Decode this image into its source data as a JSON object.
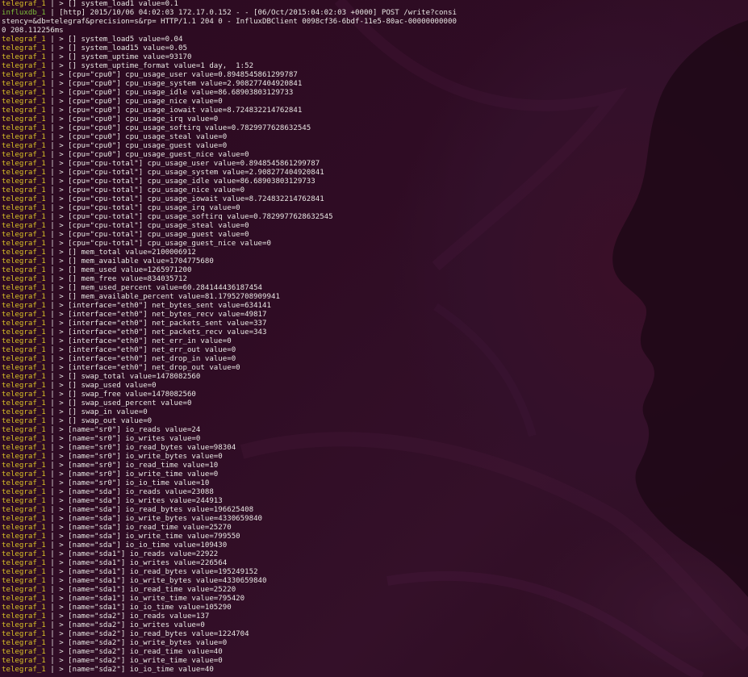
{
  "terminal": {
    "separator": " | ",
    "lines": [
      {
        "src": "telegraf_1",
        "text": "> [] system_load1 value=0.1"
      },
      {
        "src": "influxdb_1",
        "text": "[http] 2015/10/06 04:02:03 172.17.0.152 - - [06/Oct/2015:04:02:03 +0000] POST /write?consi"
      },
      {
        "src": "",
        "text": "stency=&db=telegraf&precision=s&rp= HTTP/1.1 204 0 - InfluxDBClient 0098cf36-6bdf-11e5-80ac-00000000000"
      },
      {
        "src": "",
        "text": "0 208.112256ms"
      },
      {
        "src": "telegraf_1",
        "text": "> [] system_load5 value=0.04"
      },
      {
        "src": "telegraf_1",
        "text": "> [] system_load15 value=0.05"
      },
      {
        "src": "telegraf_1",
        "text": "> [] system_uptime value=93170"
      },
      {
        "src": "telegraf_1",
        "text": "> [] system_uptime_format value=1 day,  1:52"
      },
      {
        "src": "telegraf_1",
        "text": "> [cpu=\"cpu0\"] cpu_usage_user value=0.8948545861299787"
      },
      {
        "src": "telegraf_1",
        "text": "> [cpu=\"cpu0\"] cpu_usage_system value=2.908277404920841"
      },
      {
        "src": "telegraf_1",
        "text": "> [cpu=\"cpu0\"] cpu_usage_idle value=86.68903803129733"
      },
      {
        "src": "telegraf_1",
        "text": "> [cpu=\"cpu0\"] cpu_usage_nice value=0"
      },
      {
        "src": "telegraf_1",
        "text": "> [cpu=\"cpu0\"] cpu_usage_iowait value=8.724832214762841"
      },
      {
        "src": "telegraf_1",
        "text": "> [cpu=\"cpu0\"] cpu_usage_irq value=0"
      },
      {
        "src": "telegraf_1",
        "text": "> [cpu=\"cpu0\"] cpu_usage_softirq value=0.7829977628632545"
      },
      {
        "src": "telegraf_1",
        "text": "> [cpu=\"cpu0\"] cpu_usage_steal value=0"
      },
      {
        "src": "telegraf_1",
        "text": "> [cpu=\"cpu0\"] cpu_usage_guest value=0"
      },
      {
        "src": "telegraf_1",
        "text": "> [cpu=\"cpu0\"] cpu_usage_guest_nice value=0"
      },
      {
        "src": "telegraf_1",
        "text": "> [cpu=\"cpu-total\"] cpu_usage_user value=0.8948545861299787"
      },
      {
        "src": "telegraf_1",
        "text": "> [cpu=\"cpu-total\"] cpu_usage_system value=2.908277404920841"
      },
      {
        "src": "telegraf_1",
        "text": "> [cpu=\"cpu-total\"] cpu_usage_idle value=86.68903803129733"
      },
      {
        "src": "telegraf_1",
        "text": "> [cpu=\"cpu-total\"] cpu_usage_nice value=0"
      },
      {
        "src": "telegraf_1",
        "text": "> [cpu=\"cpu-total\"] cpu_usage_iowait value=8.724832214762841"
      },
      {
        "src": "telegraf_1",
        "text": "> [cpu=\"cpu-total\"] cpu_usage_irq value=0"
      },
      {
        "src": "telegraf_1",
        "text": "> [cpu=\"cpu-total\"] cpu_usage_softirq value=0.7829977628632545"
      },
      {
        "src": "telegraf_1",
        "text": "> [cpu=\"cpu-total\"] cpu_usage_steal value=0"
      },
      {
        "src": "telegraf_1",
        "text": "> [cpu=\"cpu-total\"] cpu_usage_guest value=0"
      },
      {
        "src": "telegraf_1",
        "text": "> [cpu=\"cpu-total\"] cpu_usage_guest_nice value=0"
      },
      {
        "src": "telegraf_1",
        "text": "> [] mem_total value=2100006912"
      },
      {
        "src": "telegraf_1",
        "text": "> [] mem_available value=1704775680"
      },
      {
        "src": "telegraf_1",
        "text": "> [] mem_used value=1265971200"
      },
      {
        "src": "telegraf_1",
        "text": "> [] mem_free value=834035712"
      },
      {
        "src": "telegraf_1",
        "text": "> [] mem_used_percent value=60.284144436187454"
      },
      {
        "src": "telegraf_1",
        "text": "> [] mem_available_percent value=81.17952708909941"
      },
      {
        "src": "telegraf_1",
        "text": "> [interface=\"eth0\"] net_bytes_sent value=634141"
      },
      {
        "src": "telegraf_1",
        "text": "> [interface=\"eth0\"] net_bytes_recv value=49817"
      },
      {
        "src": "telegraf_1",
        "text": "> [interface=\"eth0\"] net_packets_sent value=337"
      },
      {
        "src": "telegraf_1",
        "text": "> [interface=\"eth0\"] net_packets_recv value=343"
      },
      {
        "src": "telegraf_1",
        "text": "> [interface=\"eth0\"] net_err_in value=0"
      },
      {
        "src": "telegraf_1",
        "text": "> [interface=\"eth0\"] net_err_out value=0"
      },
      {
        "src": "telegraf_1",
        "text": "> [interface=\"eth0\"] net_drop_in value=0"
      },
      {
        "src": "telegraf_1",
        "text": "> [interface=\"eth0\"] net_drop_out value=0"
      },
      {
        "src": "telegraf_1",
        "text": "> [] swap_total value=1478082560"
      },
      {
        "src": "telegraf_1",
        "text": "> [] swap_used value=0"
      },
      {
        "src": "telegraf_1",
        "text": "> [] swap_free value=1478082560"
      },
      {
        "src": "telegraf_1",
        "text": "> [] swap_used_percent value=0"
      },
      {
        "src": "telegraf_1",
        "text": "> [] swap_in value=0"
      },
      {
        "src": "telegraf_1",
        "text": "> [] swap_out value=0"
      },
      {
        "src": "telegraf_1",
        "text": "> [name=\"sr0\"] io_reads value=24"
      },
      {
        "src": "telegraf_1",
        "text": "> [name=\"sr0\"] io_writes value=0"
      },
      {
        "src": "telegraf_1",
        "text": "> [name=\"sr0\"] io_read_bytes value=98304"
      },
      {
        "src": "telegraf_1",
        "text": "> [name=\"sr0\"] io_write_bytes value=0"
      },
      {
        "src": "telegraf_1",
        "text": "> [name=\"sr0\"] io_read_time value=10"
      },
      {
        "src": "telegraf_1",
        "text": "> [name=\"sr0\"] io_write_time value=0"
      },
      {
        "src": "telegraf_1",
        "text": "> [name=\"sr0\"] io_io_time value=10"
      },
      {
        "src": "telegraf_1",
        "text": "> [name=\"sda\"] io_reads value=23088"
      },
      {
        "src": "telegraf_1",
        "text": "> [name=\"sda\"] io_writes value=244913"
      },
      {
        "src": "telegraf_1",
        "text": "> [name=\"sda\"] io_read_bytes value=196625408"
      },
      {
        "src": "telegraf_1",
        "text": "> [name=\"sda\"] io_write_bytes value=4330659840"
      },
      {
        "src": "telegraf_1",
        "text": "> [name=\"sda\"] io_read_time value=25270"
      },
      {
        "src": "telegraf_1",
        "text": "> [name=\"sda\"] io_write_time value=799550"
      },
      {
        "src": "telegraf_1",
        "text": "> [name=\"sda\"] io_io_time value=109430"
      },
      {
        "src": "telegraf_1",
        "text": "> [name=\"sda1\"] io_reads value=22922"
      },
      {
        "src": "telegraf_1",
        "text": "> [name=\"sda1\"] io_writes value=226564"
      },
      {
        "src": "telegraf_1",
        "text": "> [name=\"sda1\"] io_read_bytes value=195249152"
      },
      {
        "src": "telegraf_1",
        "text": "> [name=\"sda1\"] io_write_bytes value=4330659840"
      },
      {
        "src": "telegraf_1",
        "text": "> [name=\"sda1\"] io_read_time value=25220"
      },
      {
        "src": "telegraf_1",
        "text": "> [name=\"sda1\"] io_write_time value=795420"
      },
      {
        "src": "telegraf_1",
        "text": "> [name=\"sda1\"] io_io_time value=105290"
      },
      {
        "src": "telegraf_1",
        "text": "> [name=\"sda2\"] io_reads value=137"
      },
      {
        "src": "telegraf_1",
        "text": "> [name=\"sda2\"] io_writes value=0"
      },
      {
        "src": "telegraf_1",
        "text": "> [name=\"sda2\"] io_read_bytes value=1224704"
      },
      {
        "src": "telegraf_1",
        "text": "> [name=\"sda2\"] io_write_bytes value=0"
      },
      {
        "src": "telegraf_1",
        "text": "> [name=\"sda2\"] io_read_time value=40"
      },
      {
        "src": "telegraf_1",
        "text": "> [name=\"sda2\"] io_write_time value=0"
      },
      {
        "src": "telegraf_1",
        "text": "> [name=\"sda2\"] io_io_time value=40"
      }
    ],
    "colors": {
      "background": "#2a0c1e",
      "text": "#e8e6e3",
      "telegraf_tag": "#d8c027",
      "influxdb_tag": "#7cbf3a"
    }
  }
}
